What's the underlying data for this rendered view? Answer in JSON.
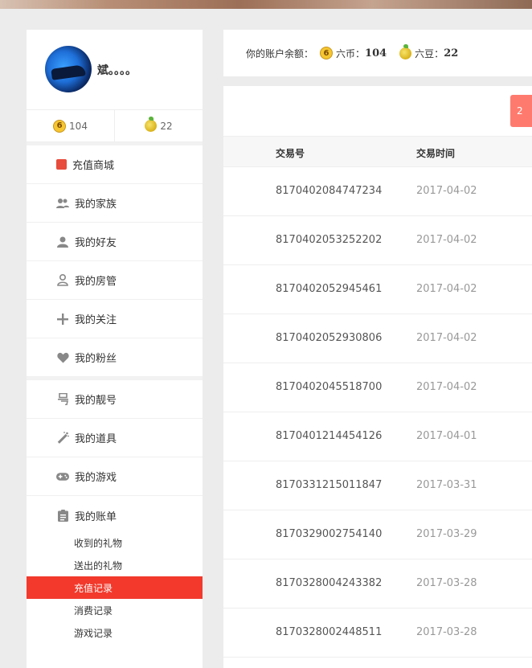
{
  "user": {
    "name": "斌。。。。"
  },
  "wallet": {
    "coins": "104",
    "beans": "22"
  },
  "menu": [
    {
      "label": "充值商城",
      "icon": "mall-icon"
    },
    {
      "label": "我的家族",
      "icon": "family-icon"
    },
    {
      "label": "我的好友",
      "icon": "friend-icon"
    },
    {
      "label": "我的房管",
      "icon": "room-admin-icon"
    },
    {
      "label": "我的关注",
      "icon": "plus-icon"
    },
    {
      "label": "我的粉丝",
      "icon": "heart-icon"
    }
  ],
  "menu2": [
    {
      "label": "我的靓号",
      "icon": "number-icon"
    },
    {
      "label": "我的道具",
      "icon": "wand-icon"
    },
    {
      "label": "我的游戏",
      "icon": "gamepad-icon"
    },
    {
      "label": "我的账单",
      "icon": "bill-icon"
    }
  ],
  "bill_submenu": [
    {
      "label": "收到的礼物",
      "active": false
    },
    {
      "label": "送出的礼物",
      "active": false
    },
    {
      "label": "充值记录",
      "active": true
    },
    {
      "label": "消费记录",
      "active": false
    },
    {
      "label": "游戏记录",
      "active": false
    }
  ],
  "balance_bar": {
    "prefix": "你的账户余额：",
    "coin_label": "六币：",
    "coin_value": "104",
    "bean_label": "六豆：",
    "bean_value": "22"
  },
  "pill_text": "2",
  "table": {
    "headers": {
      "order": "交易号",
      "time": "交易时间"
    },
    "rows": [
      {
        "order": "8170402084747234",
        "time": "2017-04-02"
      },
      {
        "order": "8170402053252202",
        "time": "2017-04-02"
      },
      {
        "order": "8170402052945461",
        "time": "2017-04-02"
      },
      {
        "order": "8170402052930806",
        "time": "2017-04-02"
      },
      {
        "order": "8170402045518700",
        "time": "2017-04-02"
      },
      {
        "order": "8170401214454126",
        "time": "2017-04-01"
      },
      {
        "order": "8170331215011847",
        "time": "2017-03-31"
      },
      {
        "order": "8170329002754140",
        "time": "2017-03-29"
      },
      {
        "order": "8170328004243382",
        "time": "2017-03-28"
      },
      {
        "order": "8170328002448511",
        "time": "2017-03-28"
      }
    ]
  },
  "colors": {
    "accent": "#f2392c",
    "pill": "#ff7a6e",
    "coin": "#f6c631"
  }
}
